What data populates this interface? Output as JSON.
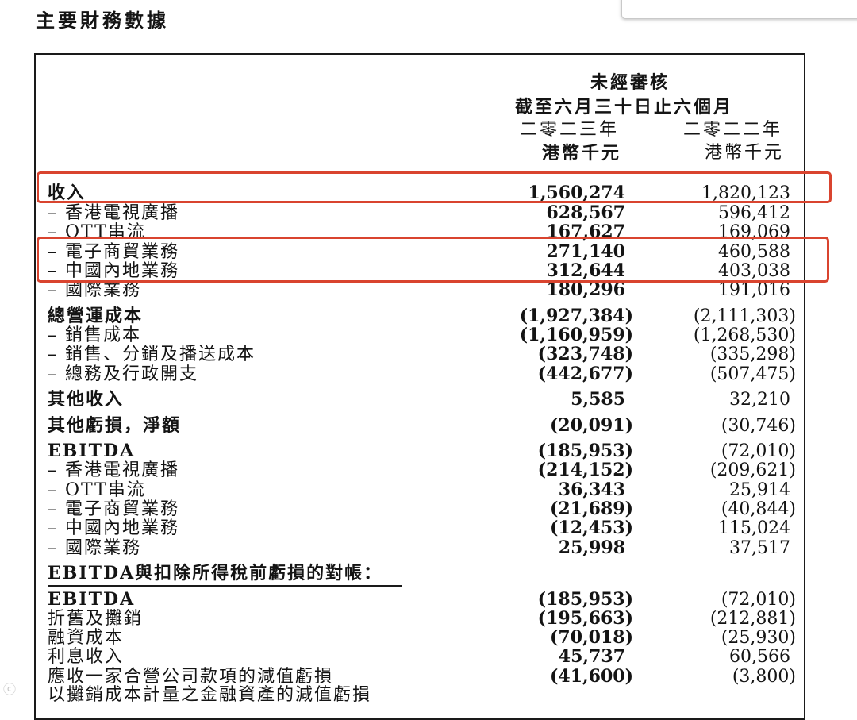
{
  "title": "主要財務數據",
  "header": {
    "unaudited": "未經審核",
    "period": "截至六月三十日止六個月",
    "year_2023": "二零二三年",
    "year_2022": "二零二二年",
    "unit_2023": "港幣千元",
    "unit_2022": "港幣千元"
  },
  "rows": [
    {
      "label": "收入",
      "v2023": "1,560,274",
      "v2022": "1,820,123"
    },
    {
      "label": "– 香港電視廣播",
      "v2023": "628,567",
      "v2022": "596,412"
    },
    {
      "label": "– OTT串流",
      "v2023": "167,627",
      "v2022": "169,069"
    },
    {
      "label": "– 電子商貿業務",
      "v2023": "271,140",
      "v2022": "460,588"
    },
    {
      "label": "– 中國內地業務",
      "v2023": "312,644",
      "v2022": "403,038"
    },
    {
      "label": "– 國際業務",
      "v2023": "180,296",
      "v2022": "191,016"
    },
    {
      "label": "總營運成本",
      "v2023": "(1,927,384)",
      "v2022": "(2,111,303)"
    },
    {
      "label": "– 銷售成本",
      "v2023": "(1,160,959)",
      "v2022": "(1,268,530)"
    },
    {
      "label": "– 銷售、分銷及播送成本",
      "v2023": "(323,748)",
      "v2022": "(335,298)"
    },
    {
      "label": "– 總務及行政開支",
      "v2023": "(442,677)",
      "v2022": "(507,475)"
    },
    {
      "label": "其他收入",
      "v2023": "5,585",
      "v2022": "32,210"
    },
    {
      "label": "其他虧損，淨額",
      "v2023": "(20,091)",
      "v2022": "(30,746)"
    },
    {
      "label": "EBITDA",
      "v2023": "(185,953)",
      "v2022": "(72,010)"
    },
    {
      "label": "– 香港電視廣播",
      "v2023": "(214,152)",
      "v2022": "(209,621)"
    },
    {
      "label": "– OTT串流",
      "v2023": "36,343",
      "v2022": "25,914"
    },
    {
      "label": "– 電子商貿業務",
      "v2023": "(21,689)",
      "v2022": "(40,844)"
    },
    {
      "label": "– 中國內地業務",
      "v2023": "(12,453)",
      "v2022": "115,024"
    },
    {
      "label": "– 國際業務",
      "v2023": "25,998",
      "v2022": "37,517"
    },
    {
      "label": "EBITDA與扣除所得稅前虧損的對帳：",
      "v2023": "",
      "v2022": ""
    },
    {
      "label": "EBITDA",
      "v2023": "(185,953)",
      "v2022": "(72,010)"
    },
    {
      "label": "折舊及攤銷",
      "v2023": "(195,663)",
      "v2022": "(212,881)"
    },
    {
      "label": "融資成本",
      "v2023": "(70,018)",
      "v2022": "(25,930)"
    },
    {
      "label": "利息收入",
      "v2023": "45,737",
      "v2022": "60,566"
    },
    {
      "label": "應收一家合營公司款項的減值虧損",
      "v2023": "(41,600)",
      "v2022": "(3,800)"
    },
    {
      "label": "以攤銷成本計量之金融資產的減值虧損",
      "v2023": "",
      "v2022": ""
    }
  ]
}
